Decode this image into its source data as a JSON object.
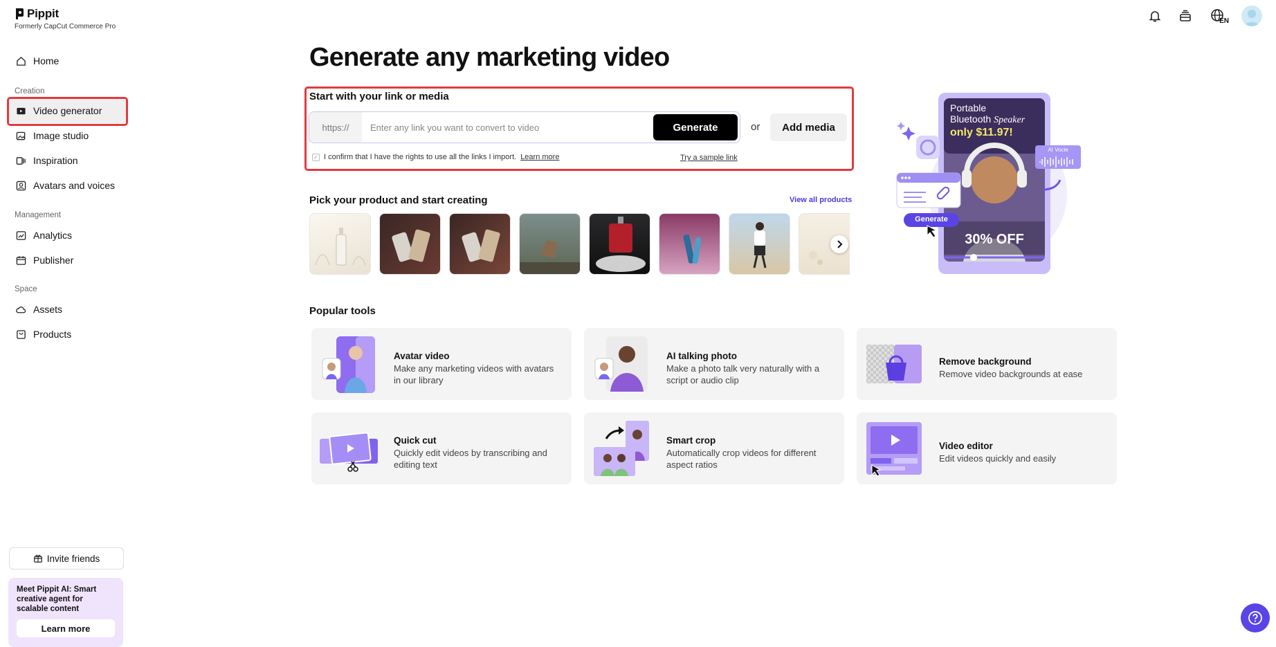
{
  "brand": {
    "name": "Pippit",
    "subtitle": "Formerly CapCut Commerce Pro"
  },
  "sidebar": {
    "home": "Home",
    "sections": {
      "creation": "Creation",
      "management": "Management",
      "space": "Space"
    },
    "items": {
      "video_generator": "Video generator",
      "image_studio": "Image studio",
      "inspiration": "Inspiration",
      "avatars_voices": "Avatars and voices",
      "analytics": "Analytics",
      "publisher": "Publisher",
      "assets": "Assets",
      "products": "Products"
    },
    "invite": "Invite friends",
    "promo": {
      "text": "Meet Pippit AI: Smart creative agent for scalable content",
      "button": "Learn more"
    }
  },
  "header": {
    "language": "EN"
  },
  "main": {
    "title": "Generate any marketing video",
    "start": {
      "label": "Start with your link or media",
      "prefix": "https://",
      "placeholder": "Enter any link you want to convert to video",
      "generate": "Generate",
      "or": "or",
      "add_media": "Add media",
      "confirm": "I confirm that I have the rights to use all the links I import.",
      "learn_more": "Learn more",
      "sample": "Try a sample link"
    },
    "pick": {
      "title": "Pick your product and start creating",
      "view_all": "View all products"
    },
    "hero": {
      "line1": "Portable",
      "line2a": "Bluetooth ",
      "line2b": "Speaker",
      "price": "only $11.97!",
      "discount": "30% OFF",
      "ai_voice": "AI Vocie",
      "generate": "Generate"
    },
    "popular": {
      "title": "Popular tools",
      "tools": [
        {
          "name": "Avatar video",
          "desc": "Make any marketing videos with avatars in our library"
        },
        {
          "name": "AI talking photo",
          "desc": "Make a photo talk very naturally with a script or audio clip"
        },
        {
          "name": "Remove background",
          "desc": "Remove video backgrounds at ease"
        },
        {
          "name": "Quick cut",
          "desc": "Quickly edit videos by transcribing and editing text"
        },
        {
          "name": "Smart crop",
          "desc": "Automatically crop videos for different aspect ratios"
        },
        {
          "name": "Video editor",
          "desc": "Edit videos quickly and easily"
        }
      ]
    }
  },
  "colors": {
    "accent": "#5a44e6",
    "highlight": "#e5393d",
    "promo_bg": "#efe4fc"
  }
}
